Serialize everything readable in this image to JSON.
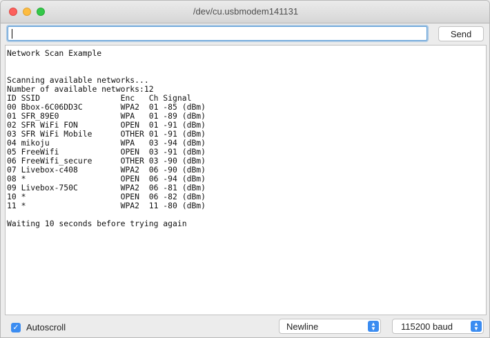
{
  "window": {
    "title": "/dev/cu.usbmodem141131"
  },
  "input": {
    "value": "",
    "send_label": "Send"
  },
  "output": {
    "lines": [
      "Network Scan Example",
      "",
      "",
      "Scanning available networks...",
      "Number of available networks:12",
      "ID SSID                 Enc   Ch Signal",
      "00 Bbox-6C06DD3C        WPA2  01 -85 (dBm)",
      "01 SFR_89E0             WPA   01 -89 (dBm)",
      "02 SFR WiFi FON         OPEN  01 -91 (dBm)",
      "03 SFR WiFi Mobile      OTHER 01 -91 (dBm)",
      "04 mikoju               WPA   03 -94 (dBm)",
      "05 FreeWifi             OPEN  03 -91 (dBm)",
      "06 FreeWifi_secure      OTHER 03 -90 (dBm)",
      "07 Livebox-c408         WPA2  06 -90 (dBm)",
      "08 *                    OPEN  06 -94 (dBm)",
      "09 Livebox-750C         WPA2  06 -81 (dBm)",
      "10 *                    OPEN  06 -82 (dBm)",
      "11 *                    WPA2  11 -80 (dBm)",
      "",
      "Waiting 10 seconds before trying again"
    ]
  },
  "footer": {
    "autoscroll_label": "Autoscroll",
    "autoscroll_checked": true,
    "line_ending": "Newline",
    "baud_rate": "115200 baud"
  },
  "colors": {
    "accent": "#3b8cf1",
    "close": "#fc605c",
    "minimize": "#fdbc40",
    "maximize": "#34c84a"
  }
}
